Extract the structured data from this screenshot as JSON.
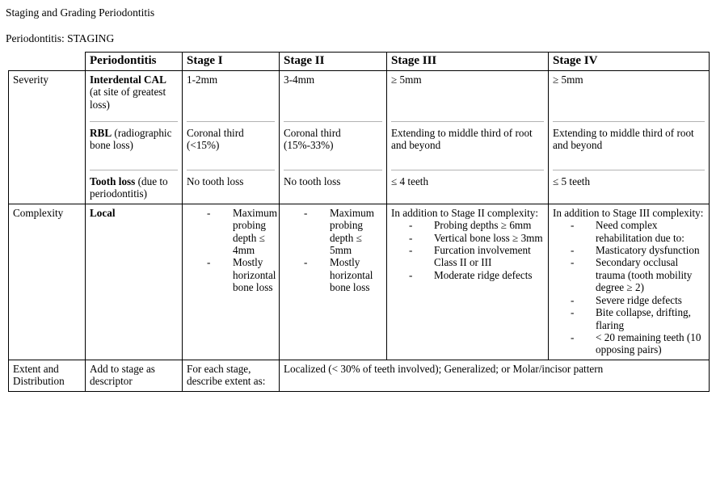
{
  "document": {
    "heading": "Staging and Grading Periodontitis",
    "subheading": "Periodontitis: STAGING"
  },
  "table": {
    "header": {
      "corner": "",
      "periodontitis": "Periodontitis",
      "stage1": "Stage I",
      "stage2": "Stage II",
      "stage3": "Stage III",
      "stage4": "Stage IV"
    },
    "rows": {
      "severity": {
        "label": "Severity",
        "criteria": {
          "cal_bold": "Interdental CAL",
          "cal_rest": " (at site of greatest loss)",
          "rbl_bold": "RBL",
          "rbl_rest": " (radiographic bone loss)",
          "tooth_bold": "Tooth loss",
          "tooth_rest": " (due to periodontitis)"
        },
        "stage1": {
          "cal": "1-2mm",
          "rbl": "Coronal third (<15%)",
          "tooth": "No tooth loss"
        },
        "stage2": {
          "cal": "3-4mm",
          "rbl": "Coronal third (15%-33%)",
          "tooth": "No tooth loss"
        },
        "stage3": {
          "cal": "≥ 5mm",
          "rbl": "Extending to middle third of root and beyond",
          "tooth": "≤ 4 teeth"
        },
        "stage4": {
          "cal": "≥ 5mm",
          "rbl": "Extending to middle third of root and beyond",
          "tooth": "≤ 5 teeth"
        }
      },
      "complexity": {
        "label": "Complexity",
        "criteria": "Local",
        "stage1_items": [
          "Maximum probing depth ≤ 4mm",
          "Mostly horizontal bone loss"
        ],
        "stage2_items": [
          "Maximum probing depth ≤ 5mm",
          "Mostly horizontal bone loss"
        ],
        "stage3_intro": "In addition to Stage II complexity:",
        "stage3_items": [
          "Probing depths ≥ 6mm",
          "Vertical bone loss ≥ 3mm",
          "Furcation involvement Class II or III",
          "Moderate ridge defects"
        ],
        "stage4_intro": "In addition to Stage III complexity:",
        "stage4_items": [
          "Need complex rehabilitation due to:",
          "Masticatory dysfunction",
          "Secondary occlusal trauma (tooth mobility degree ≥ 2)",
          "Severe ridge defects",
          "Bite collapse, drifting, flaring",
          "< 20 remaining teeth (10 opposing pairs)"
        ]
      },
      "extent": {
        "label": "Extent and Distribution",
        "criteria": "Add to stage as descriptor",
        "stage1": "For each stage, describe extent as:",
        "stage2_merged": "Localized (< 30% of teeth involved); Generalized; or Molar/incisor pattern"
      }
    }
  }
}
